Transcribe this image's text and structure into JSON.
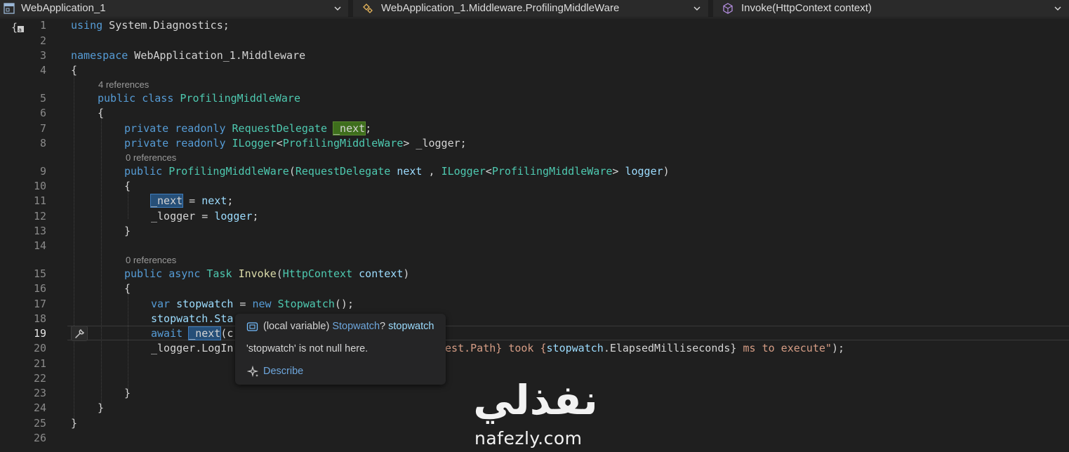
{
  "navbar": {
    "project": "WebApplication_1",
    "type_scope": "WebApplication_1.Middleware.ProfilingMiddleWare",
    "member_scope": "Invoke(HttpContext context)"
  },
  "code_lens": {
    "class_refs": "4 references",
    "ctor_refs": "0 references",
    "invoke_refs": "0 references"
  },
  "line_numbers": [
    "1",
    "2",
    "3",
    "4",
    "5",
    "6",
    "7",
    "8",
    "9",
    "10",
    "11",
    "12",
    "13",
    "14",
    "15",
    "16",
    "17",
    "18",
    "19",
    "20",
    "21",
    "22",
    "23",
    "24",
    "25",
    "26"
  ],
  "active_line": "19",
  "code": {
    "l1": {
      "kw": "using",
      "rest": " System.Diagnostics;"
    },
    "l3": {
      "kw": "namespace",
      "rest": " WebApplication_1.Middleware"
    },
    "l4": "{",
    "l5": {
      "kw1": "public",
      "kw2": "class",
      "name": "ProfilingMiddleWare"
    },
    "l6": "{",
    "l7": {
      "kw1": "private",
      "kw2": "readonly",
      "type": "RequestDelegate",
      "field": "_next",
      "end": ";"
    },
    "l8": {
      "kw1": "private",
      "kw2": "readonly",
      "type": "ILogger",
      "lt": "<",
      "arg": "ProfilingMiddleWare",
      "gt": ">",
      "field": " _logger;"
    },
    "l9": {
      "kw": "public",
      "name": "ProfilingMiddleWare",
      "open": "(",
      "type1": "RequestDelegate",
      "p1": " next",
      "sep": " , ",
      "type2": "ILogger",
      "lt": "<",
      "arg": "ProfilingMiddleWare",
      "gt": ">",
      "p2": " logger",
      "close": ")"
    },
    "l10": "{",
    "l11": {
      "field": "_next",
      "op": " = ",
      "val": "next",
      "end": ";"
    },
    "l12": {
      "field": "_logger",
      "op": " = ",
      "val": "logger",
      "end": ";"
    },
    "l13": "}",
    "l15": {
      "kw1": "public",
      "kw2": "async",
      "type": "Task",
      "name": "Invoke",
      "open": "(",
      "ptype": "HttpContext",
      "pname": " context",
      "close": ")"
    },
    "l16": "{",
    "l17": {
      "kw": "var",
      "var": " stopwatch",
      "op": " = ",
      "kw2": "new",
      "type": " Stopwatch",
      "end": "();"
    },
    "l18": {
      "text": "stopwatch.Sta"
    },
    "l19": {
      "kw": "await",
      "field": "_next",
      "rest": "(c"
    },
    "l20a": {
      "text": "_logger.LogIn"
    },
    "l20b": {
      "str1": "uest.Path} took {",
      "var": "stopwatch",
      "mid": ".ElapsedMilliseconds}",
      "str2": " ms to execute\"",
      "end": ");"
    },
    "l23": "}",
    "l24": "}",
    "l25": "}"
  },
  "tooltip": {
    "kind": "(local variable)",
    "type": "Stopwatch",
    "nullable": "?",
    "name": "stopwatch",
    "null_state": "'stopwatch' is not null here.",
    "describe": "Describe"
  },
  "watermark": {
    "arabic": "نفذلي",
    "latin": "nafezly.com"
  },
  "icons": {
    "project": "project-icon",
    "type_scope": "class-scope-icon",
    "member_scope": "method-cube-icon",
    "gutter_action": "wrench-icon",
    "tooltip_symbol": "local-variable-icon",
    "describe": "sparkle-icon"
  }
}
